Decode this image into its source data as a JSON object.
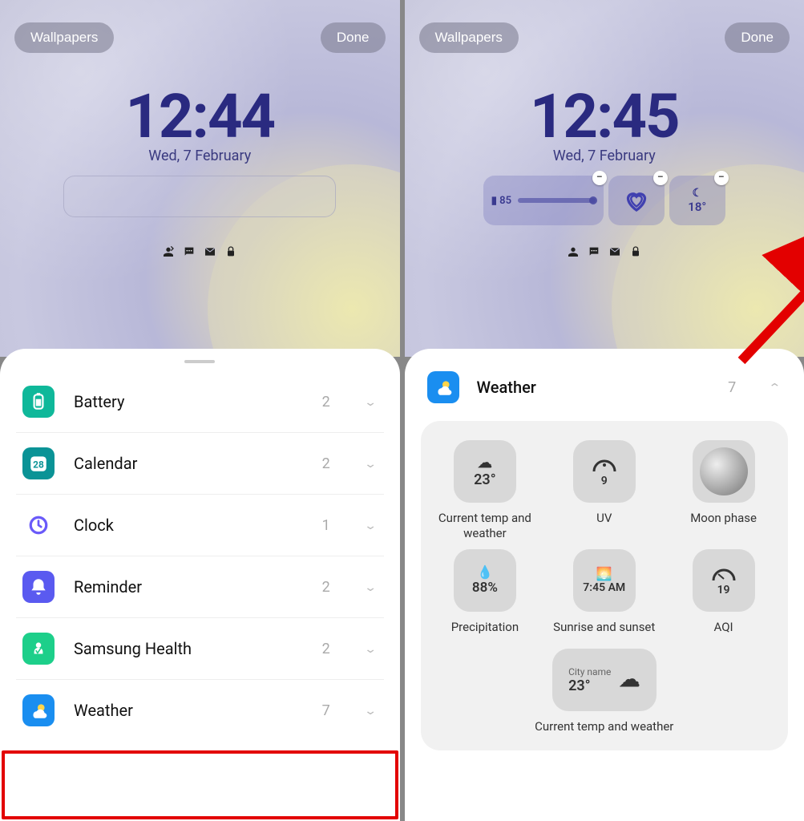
{
  "left": {
    "wallpapers_label": "Wallpapers",
    "done_label": "Done",
    "time": "12:44",
    "date": "Wed, 7 February",
    "categories": [
      {
        "key": "battery",
        "label": "Battery",
        "count": "2",
        "color": "ic-battery"
      },
      {
        "key": "calendar",
        "label": "Calendar",
        "count": "2",
        "color": "ic-calendar"
      },
      {
        "key": "clock",
        "label": "Clock",
        "count": "1",
        "color": "ic-clock"
      },
      {
        "key": "reminder",
        "label": "Reminder",
        "count": "2",
        "color": "ic-reminder"
      },
      {
        "key": "health",
        "label": "Samsung Health",
        "count": "2",
        "color": "ic-health"
      },
      {
        "key": "weather",
        "label": "Weather",
        "count": "7",
        "color": "ic-weather"
      }
    ]
  },
  "right": {
    "wallpapers_label": "Wallpapers",
    "done_label": "Done",
    "time": "12:45",
    "date": "Wed, 7 February",
    "battery_widget_value": "85",
    "temp_widget_value": "18°",
    "section_label": "Weather",
    "section_count": "7",
    "tiles": {
      "t1": {
        "value": "23°",
        "label": "Current temp and weather"
      },
      "t2": {
        "value": "9",
        "label": "UV"
      },
      "t3": {
        "value": "",
        "label": "Moon phase"
      },
      "t4": {
        "value": "88%",
        "label": "Precipitation"
      },
      "t5": {
        "value": "7:45 AM",
        "label": "Sunrise and sunset"
      },
      "t6": {
        "value": "19",
        "label": "AQI"
      },
      "t7": {
        "title": "City name",
        "value": "23°",
        "label": "Current temp and weather"
      }
    }
  }
}
